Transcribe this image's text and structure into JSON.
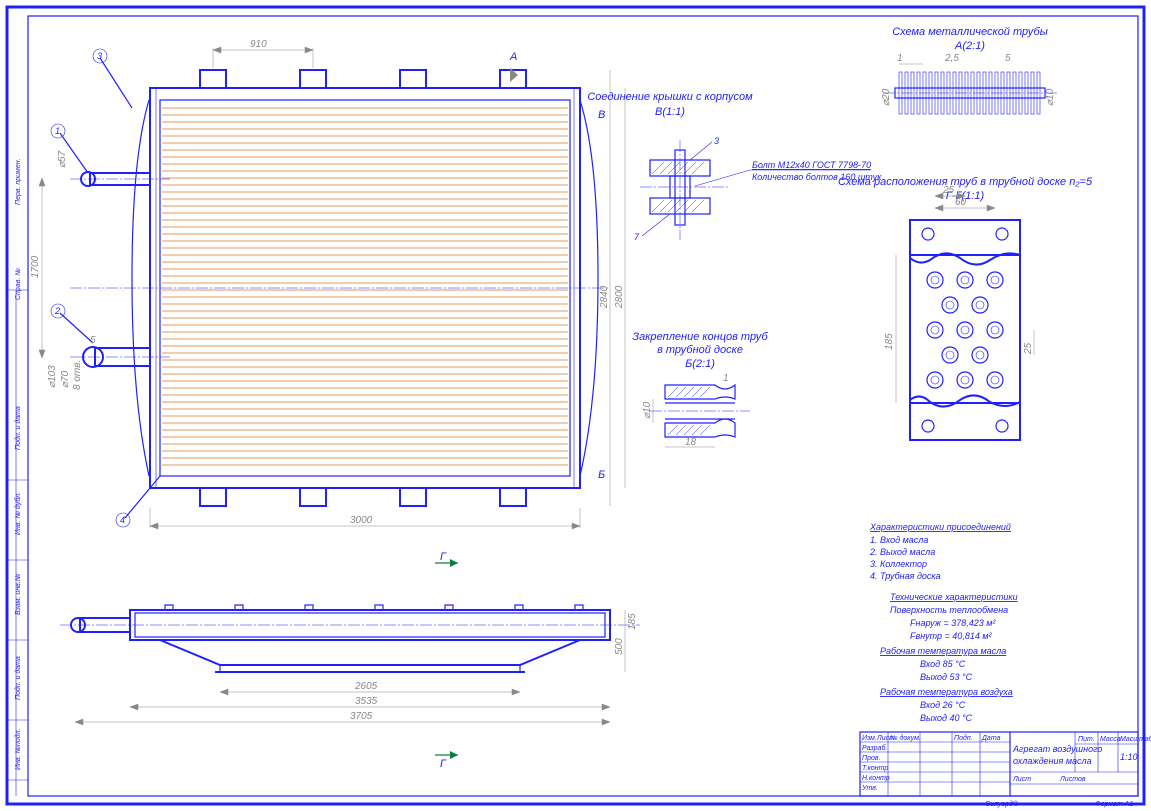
{
  "frame": {
    "format_label": "Формат  А1",
    "signed_by": "Силуорд®"
  },
  "title_block": {
    "title_line1": "Агрегат воздушного",
    "title_line2": "охлаждения масла",
    "col_num": "Пит.",
    "col_mass": "Масса",
    "col_scale": "Масштаб",
    "mass": "",
    "scale": "1:10",
    "sheets_label": "Лист",
    "total_sheets_label": "Листов",
    "row_izm": "Изм.Лист",
    "row_ndoc": "№ докум.",
    "row_sign": "Подп.",
    "row_date": "Дата",
    "row_razrab": "Разраб.",
    "row_prov": "Пров.",
    "row_tkont": "Т.контр",
    "row_nkont": "Н.контр",
    "row_utv": "Утв."
  },
  "main_view": {
    "dim_horiz_top": "910",
    "dim_horiz_bottom": "3000",
    "dim_vert_outer": "1700",
    "dim_vert_right1": "2840",
    "dim_vert_right2": "2800",
    "dim_d_57": "⌀57",
    "dim_s_5": "5",
    "dim_d_103": "⌀103",
    "dim_d_70": "⌀70",
    "dim_b_otv": "8 отв.",
    "section_A": "А",
    "section_B": "В",
    "section_Bb": "Б",
    "leader_1": "1",
    "leader_2": "2",
    "leader_3": "3",
    "leader_4": "4",
    "section_G": "Г"
  },
  "bottom_view": {
    "dim_3705": "3705",
    "dim_3535": "3535",
    "dim_2605": "2605",
    "dim_500": "500",
    "dim_185": "185"
  },
  "detail_A": {
    "title": "Схема металлической трубы",
    "label": "А(2:1)",
    "dim_1": "1",
    "dim_25": "2,5",
    "dim_5": "5",
    "dim_d20": "⌀20",
    "dim_d10": "⌀10"
  },
  "detail_B_cover": {
    "title": "Соединение крышки с корпусом",
    "label": "В(1:1)",
    "leader_7": "7",
    "leader_3": "3",
    "note_line1": "Болт М12х40 ГОСТ 7798-70",
    "note_line2": "Количество болтов 160 штук"
  },
  "detail_B_tube": {
    "title_line1": "Закрепление концов труб",
    "title_line2": "в трубной доске",
    "label": "Б(2:1)",
    "dim_d10": "⌀10",
    "dim_18": "18",
    "dim_1": "1"
  },
  "detail_G": {
    "title": "Схема расположения труб в трубной доске n₂=5",
    "label": "Г-Г(1:1)",
    "dim_60": "60",
    "dim_25": "25",
    "dim_185": "185",
    "dim_25v": "25"
  },
  "notes": {
    "hdr_conn": "Характеристики присоединений",
    "c1": "1. Вход масла",
    "c2": "2. Выход масла",
    "c3": "3. Коллектор",
    "c4": "4. Трубная доска",
    "hdr_tech": "Технические характеристики",
    "t1": "Поверхность теплообмена",
    "t2": "Fнаруж = 378,423 м²",
    "t3": "Fвнутр = 40,814 м²",
    "hdr_oil": "Рабочая температура масла",
    "o1": "Вход 85 °С",
    "o2": "Выход 53 °С",
    "hdr_air": "Рабочая температура воздуха",
    "a1": "Вход 26 °С",
    "a2": "Выход 40 °С"
  }
}
